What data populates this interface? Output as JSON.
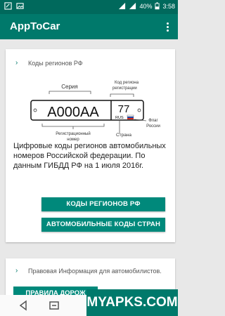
{
  "status_bar": {
    "battery_percent": "40%",
    "time": "3:58"
  },
  "app_bar": {
    "title": "AppToCar"
  },
  "card1": {
    "header": "Коды регионов РФ",
    "plate": {
      "number": "А000АА",
      "region": "77",
      "country_code": "RUS",
      "label_series": "Серия",
      "label_region_code": "Код региона регистрации",
      "label_flag": "Флаг России",
      "label_reg_number": "Регистрационный номер",
      "label_country": "Страна"
    },
    "body_text": "Цифровые коды регионов автомобильных номеров Российской федерации. По данным ГИБДД РФ на 1 июля 2016г.",
    "button_regions": "КОДЫ РЕГИОНОВ РФ",
    "button_countries": "АВТОМОБИЛЬНЫЕ КОДЫ СТРАН"
  },
  "card2": {
    "header": "Правовая Информация для автомобилистов.",
    "button_partial": "ПРАВИЛА ДОРОЖ"
  },
  "watermark": "MYAPKS.COM",
  "colors": {
    "primary": "#00796b",
    "primary_dark": "#00695c",
    "button": "#00897b"
  }
}
